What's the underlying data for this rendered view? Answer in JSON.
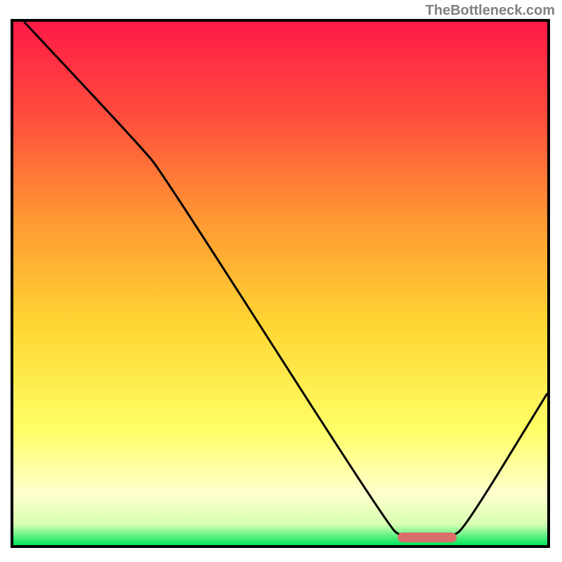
{
  "watermark": "TheBottleneck.com",
  "chart_data": {
    "type": "line",
    "title": "",
    "xlabel": "",
    "ylabel": "",
    "xlim": [
      0,
      100
    ],
    "ylim": [
      0,
      100
    ],
    "gradient_top_color": "#ff1a47",
    "gradient_upper_mid_color": "#ff7a33",
    "gradient_mid_color": "#ffd633",
    "gradient_lower_color": "#ffff66",
    "gradient_pale_color": "#ffffcc",
    "gradient_bottom_color": "#00e65c",
    "curve_color": "#000000",
    "curve_points": [
      {
        "x": 2,
        "y": 100
      },
      {
        "x": 24,
        "y": 76
      },
      {
        "x": 28,
        "y": 71
      },
      {
        "x": 70,
        "y": 4
      },
      {
        "x": 73,
        "y": 1.2
      },
      {
        "x": 82,
        "y": 1.2
      },
      {
        "x": 85,
        "y": 4
      },
      {
        "x": 100,
        "y": 29
      }
    ],
    "marker": {
      "x_start": 72,
      "x_end": 83,
      "y": 1.5,
      "color": "#d96f6a"
    }
  }
}
